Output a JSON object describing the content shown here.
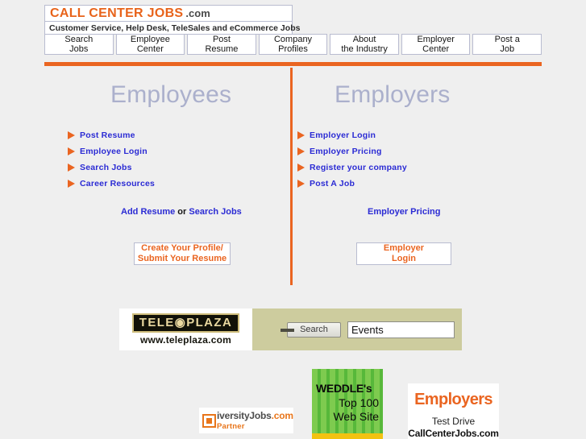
{
  "header": {
    "logo_main": "CALL CENTER JOBS",
    "logo_dotcom": ".com",
    "tagline": "Customer Service, Help Desk, TeleSales and eCommerce Jobs"
  },
  "nav_tabs": [
    {
      "line1": "Search",
      "line2": "Jobs"
    },
    {
      "line1": "Employee",
      "line2": "Center"
    },
    {
      "line1": "Post",
      "line2": "Resume"
    },
    {
      "line1": "Company",
      "line2": "Profiles"
    },
    {
      "line1": "About",
      "line2": "the Industry"
    },
    {
      "line1": "Employer",
      "line2": "Center"
    },
    {
      "line1": "Post a",
      "line2": "Job"
    }
  ],
  "employees": {
    "heading": "Employees",
    "links": [
      "Post Resume",
      "Employee Login",
      "Search Jobs",
      "Career Resources"
    ],
    "mid_link_1": "Add Resume",
    "mid_conjunction": " or ",
    "mid_link_2": "Search Jobs",
    "button_line1": "Create Your Profile/",
    "button_line2": "Submit Your Resume"
  },
  "employers": {
    "heading": "Employers",
    "links": [
      "Employer Login",
      "Employer Pricing",
      "Register your company",
      "Post A Job"
    ],
    "mid_link": "Employer Pricing",
    "button_line1": "Employer",
    "button_line2": "Login"
  },
  "banner": {
    "teleplaza_logo": "TELE◉PLAZA",
    "teleplaza_url": "www.teleplaza.com",
    "search_button_label": "Search",
    "search_input_value": "Events",
    "search_input_placeholder": ""
  },
  "badges": {
    "diversity": {
      "name": "iversityJobs",
      "dot_com": ".com",
      "partner": "Partner"
    },
    "weddle": {
      "title": "WEDDLE's",
      "line1": "Top 100",
      "line2": "Web Site"
    },
    "employers": {
      "word": "Employers",
      "line1": "Test Drive",
      "line2": "CallCenterJobs.com"
    }
  },
  "colors": {
    "orange": "#ea6521",
    "link_blue": "#2b2bd4",
    "heading_gray": "#abb0cc",
    "page_bg": "#efefef",
    "banner_khaki": "#cdcc9e"
  }
}
